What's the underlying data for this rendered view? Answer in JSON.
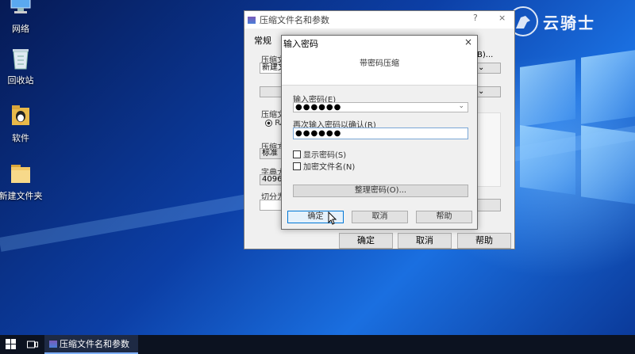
{
  "desktop": {
    "icons": [
      {
        "label": "网络",
        "icon": "network-icon"
      },
      {
        "label": "回收站",
        "icon": "recycle-bin-icon"
      },
      {
        "label": "软件",
        "icon": "software-folder-icon"
      },
      {
        "label": "新建文件夹",
        "icon": "folder-icon"
      }
    ]
  },
  "watermark": {
    "text": "云骑士"
  },
  "back_window": {
    "title": "压缩文件名和参数",
    "title_buttons": {
      "help": "?",
      "close": "×"
    },
    "tab": "常规",
    "labels": {
      "archive_name": "压缩文",
      "compression": "压缩文",
      "method": "压缩方",
      "dictionary": "字典大",
      "split": "切分为"
    },
    "fields": {
      "archive_name_value": "新建文",
      "browse": "B)...",
      "format_radio": "RA",
      "method_value": "标准",
      "dictionary_value": "4096 K"
    },
    "buttons": {
      "ok": "确定",
      "cancel": "取消",
      "help": "帮助"
    }
  },
  "password_dialog": {
    "title": "输入密码",
    "close": "×",
    "header": "带密码压缩",
    "enter_label": "输入密码(E)",
    "enter_value": "●●●●●●",
    "confirm_label": "再次输入密码以确认(R)",
    "confirm_value": "●●●●●●",
    "show_password": "显示密码(S)",
    "encrypt_filenames": "加密文件名(N)",
    "organize_button": "整理密码(O)...",
    "buttons": {
      "ok": "确定",
      "cancel": "取消",
      "help": "帮助"
    }
  },
  "taskbar": {
    "app_label": "压缩文件名和参数"
  },
  "colors": {
    "accent": "#0078d7",
    "desktop": "#0c3fa6",
    "taskbar": "#0c1220"
  }
}
